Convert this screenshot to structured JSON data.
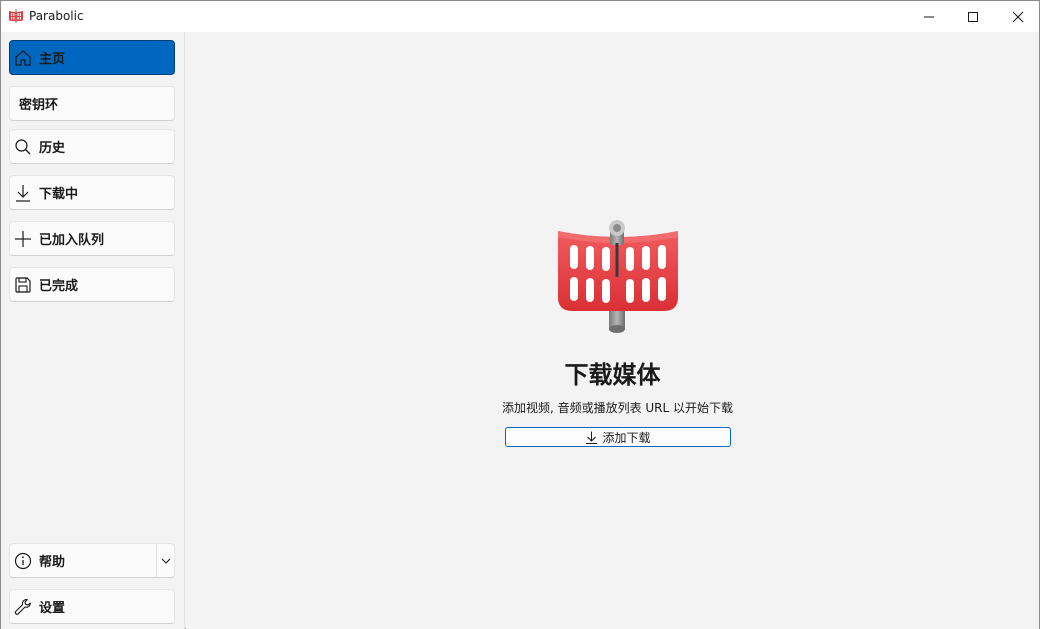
{
  "window": {
    "title": "Parabolic",
    "controls": [
      "minimize-icon",
      "maximize-icon",
      "close-icon"
    ]
  },
  "sidebar": {
    "items": [
      {
        "label": "主页",
        "icon": "home-icon",
        "active": true
      },
      {
        "label": "密钥环",
        "icon": "",
        "active": false
      },
      {
        "label": "历史",
        "icon": "search-icon",
        "active": false
      },
      {
        "label": "下载中",
        "icon": "download-arrow-icon",
        "active": false
      },
      {
        "label": "已加入队列",
        "icon": "plus-icon",
        "active": false
      },
      {
        "label": "已完成",
        "icon": "save-icon",
        "active": false
      }
    ],
    "bottom": [
      {
        "label": "帮助",
        "icon": "info-icon",
        "has_dropdown": true
      },
      {
        "label": "设置",
        "icon": "wrench-icon"
      }
    ]
  },
  "main": {
    "title": "下载媒体",
    "description": "添加视频, 音频或播放列表 URL 以开始下载",
    "button_label": "添加下载"
  },
  "colors": {
    "accent": "#0067c0",
    "logo_red": "#e83a3f",
    "background": "#f3f3f3"
  }
}
